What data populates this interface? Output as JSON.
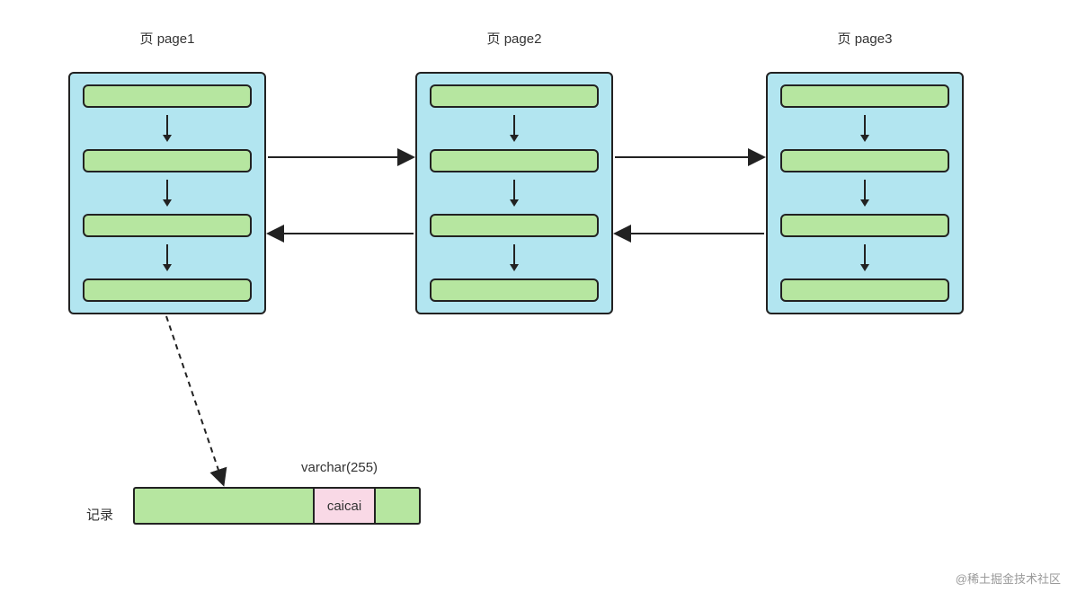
{
  "pages": {
    "p1": {
      "label": "页 page1"
    },
    "p2": {
      "label": "页 page2"
    },
    "p3": {
      "label": "页 page3"
    }
  },
  "record": {
    "label": "记录",
    "field_type": "varchar(255)",
    "value": "caicai"
  },
  "watermark": "@稀土掘金技术社区"
}
